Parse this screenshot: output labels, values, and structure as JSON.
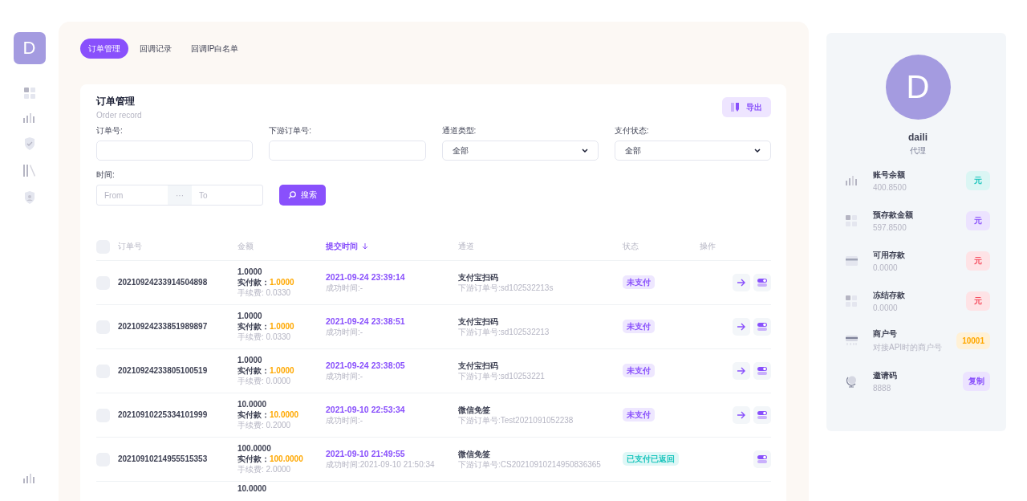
{
  "sidebar": {
    "avatar": "D"
  },
  "tabs": [
    {
      "label": "订单管理",
      "selected": true
    },
    {
      "label": "回调记录",
      "selected": false
    },
    {
      "label": "回调IP白名单",
      "selected": false
    }
  ],
  "card": {
    "title": "订单管理",
    "subtitle": "Order record",
    "export_button": "导出"
  },
  "filters": [
    {
      "label": "订单号:",
      "kind": "input"
    },
    {
      "label": "下游订单号:",
      "kind": "input"
    },
    {
      "label": "通道类型:",
      "kind": "select",
      "value": "全部"
    },
    {
      "label": "支付状态:",
      "kind": "select",
      "value": "全部"
    }
  ],
  "time_filter": {
    "label": "时间:",
    "from_placeholder": "From",
    "separator": "···",
    "to_placeholder": "To"
  },
  "search_button": "搜索",
  "table": {
    "all_checked": false,
    "columns": [
      {
        "label": "订单号",
        "sorted": false
      },
      {
        "label": "金额",
        "sorted": false
      },
      {
        "label": "提交时间",
        "sorted": true
      },
      {
        "label": "通道",
        "sorted": false
      },
      {
        "label": "状态",
        "sorted": false
      },
      {
        "label": "操作",
        "sorted": false
      }
    ],
    "rows": [
      {
        "checked": false,
        "order_no": "20210924233914504898",
        "amount": "1.0000",
        "paid_label": "实付款：",
        "paid": "1.0000",
        "fee": "手续费: 0.0330",
        "time": "2021-09-24 23:39:14",
        "success_time": "成功时间:-",
        "channel": "支付宝扫码",
        "downstream": "下游订单号:sd102532213s",
        "status": {
          "label": "未支付",
          "color": "#8950fc"
        },
        "can_forward": true
      },
      {
        "checked": false,
        "order_no": "20210924233851989897",
        "amount": "1.0000",
        "paid_label": "实付款：",
        "paid": "1.0000",
        "fee": "手续费: 0.0330",
        "time": "2021-09-24 23:38:51",
        "success_time": "成功时间:-",
        "channel": "支付宝扫码",
        "downstream": "下游订单号:sd102532213",
        "status": {
          "label": "未支付",
          "color": "#8950fc"
        },
        "can_forward": true
      },
      {
        "checked": false,
        "order_no": "20210924233805100519",
        "amount": "1.0000",
        "paid_label": "实付款：",
        "paid": "1.0000",
        "fee": "手续费: 0.0000",
        "time": "2021-09-24 23:38:05",
        "success_time": "成功时间:-",
        "channel": "支付宝扫码",
        "downstream": "下游订单号:sd10253221",
        "status": {
          "label": "未支付",
          "color": "#8950fc"
        },
        "can_forward": true
      },
      {
        "checked": false,
        "order_no": "20210910225334101999",
        "amount": "10.0000",
        "paid_label": "实付款：",
        "paid": "10.0000",
        "fee": "手续费: 0.2000",
        "time": "2021-09-10 22:53:34",
        "success_time": "成功时间:-",
        "channel": "微信免签",
        "downstream": "下游订单号:Test2021091052238",
        "status": {
          "label": "未支付",
          "color": "#8950fc"
        },
        "can_forward": true
      },
      {
        "checked": false,
        "order_no": "20210910214955515353",
        "amount": "100.0000",
        "paid_label": "实付款：",
        "paid": "100.0000",
        "fee": "手续费: 2.0000",
        "time": "2021-09-10 21:49:55",
        "success_time": "成功时间:2021-09-10 21:50:34",
        "channel": "微信免签",
        "downstream": "下游订单号:CS20210910214950836365",
        "status": {
          "label": "已支付已返回",
          "color": "#1bc5bd"
        },
        "can_forward": false
      },
      {
        "amount": "10.0000"
      }
    ]
  },
  "profile": {
    "avatar": "D",
    "name": "daili",
    "role": "代理",
    "stats": [
      {
        "label": "账号余额",
        "value": "400.8500",
        "badge": {
          "label": "元",
          "color": "#1bc5bd"
        }
      },
      {
        "label": "预存款金额",
        "value": "597.8500",
        "badge": {
          "label": "元",
          "color": "#8950fc"
        }
      },
      {
        "label": "可用存款",
        "value": "0.0000",
        "badge": {
          "label": "元",
          "color": "#f64e60"
        }
      },
      {
        "label": "冻结存款",
        "value": "0.0000",
        "badge": {
          "label": "元",
          "color": "#f64e60"
        }
      },
      {
        "label": "商户号",
        "value": "对接API时的商户号",
        "badge": {
          "label": "10001",
          "color": "#ffa800"
        }
      },
      {
        "label": "邀请码",
        "value": "8888",
        "badge": {
          "label": "复制",
          "color": "#8950fc"
        }
      }
    ]
  }
}
